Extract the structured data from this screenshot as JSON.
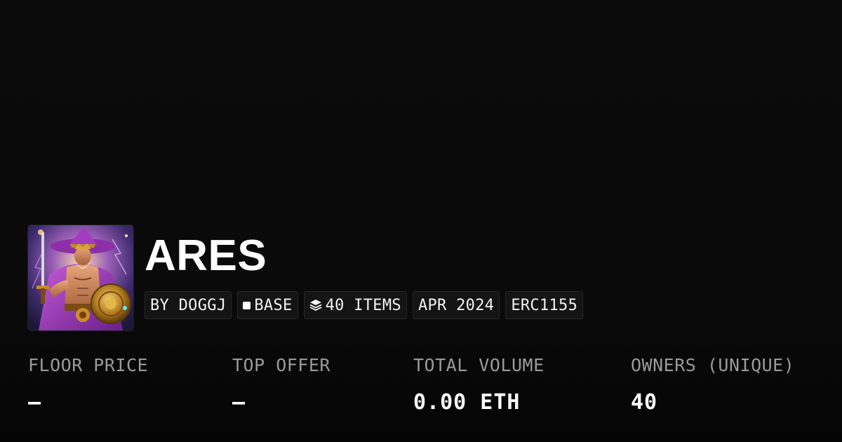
{
  "collection": {
    "title": "ARES",
    "avatar_icon": "wizard-warrior-artwork",
    "tags": {
      "creator": "BY DOGGJ",
      "chain": "BASE",
      "chain_icon": "square-icon",
      "items": "40 ITEMS",
      "items_icon": "layers-icon",
      "date": "APR 2024",
      "standard": "ERC1155"
    }
  },
  "stats": {
    "floor_price": {
      "label": "FLOOR PRICE",
      "value": "—"
    },
    "top_offer": {
      "label": "TOP OFFER",
      "value": "—"
    },
    "total_volume": {
      "label": "TOTAL VOLUME",
      "value": "0.00 ETH"
    },
    "owners": {
      "label": "OWNERS (UNIQUE)",
      "value": "40"
    }
  },
  "colors": {
    "background": "#0b0b0b",
    "tag_background": "#141414",
    "tag_border": "#262626",
    "label": "#9a9a9a",
    "value": "#ffffff"
  }
}
